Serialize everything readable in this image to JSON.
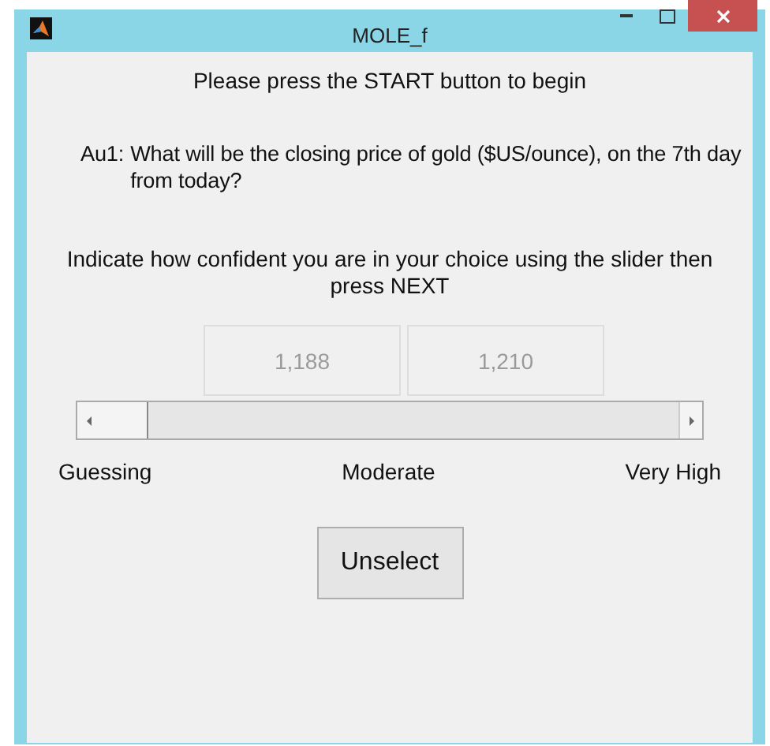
{
  "window": {
    "title": "MOLE_f"
  },
  "instruction": "Please press the START button to begin",
  "question": {
    "label": "Au1:",
    "text": "What will be the closing price of gold ($US/ounce), on the 7th day from today?"
  },
  "prompt": "Indicate how confident you are in your choice using the slider then press NEXT",
  "choices": [
    {
      "label": "1,188",
      "disabled": true
    },
    {
      "label": "1,210",
      "disabled": true
    }
  ],
  "slider": {
    "level": 0
  },
  "scale_labels": [
    "Guessing",
    "Moderate",
    "Very High"
  ],
  "buttons": [
    "Unselect"
  ]
}
